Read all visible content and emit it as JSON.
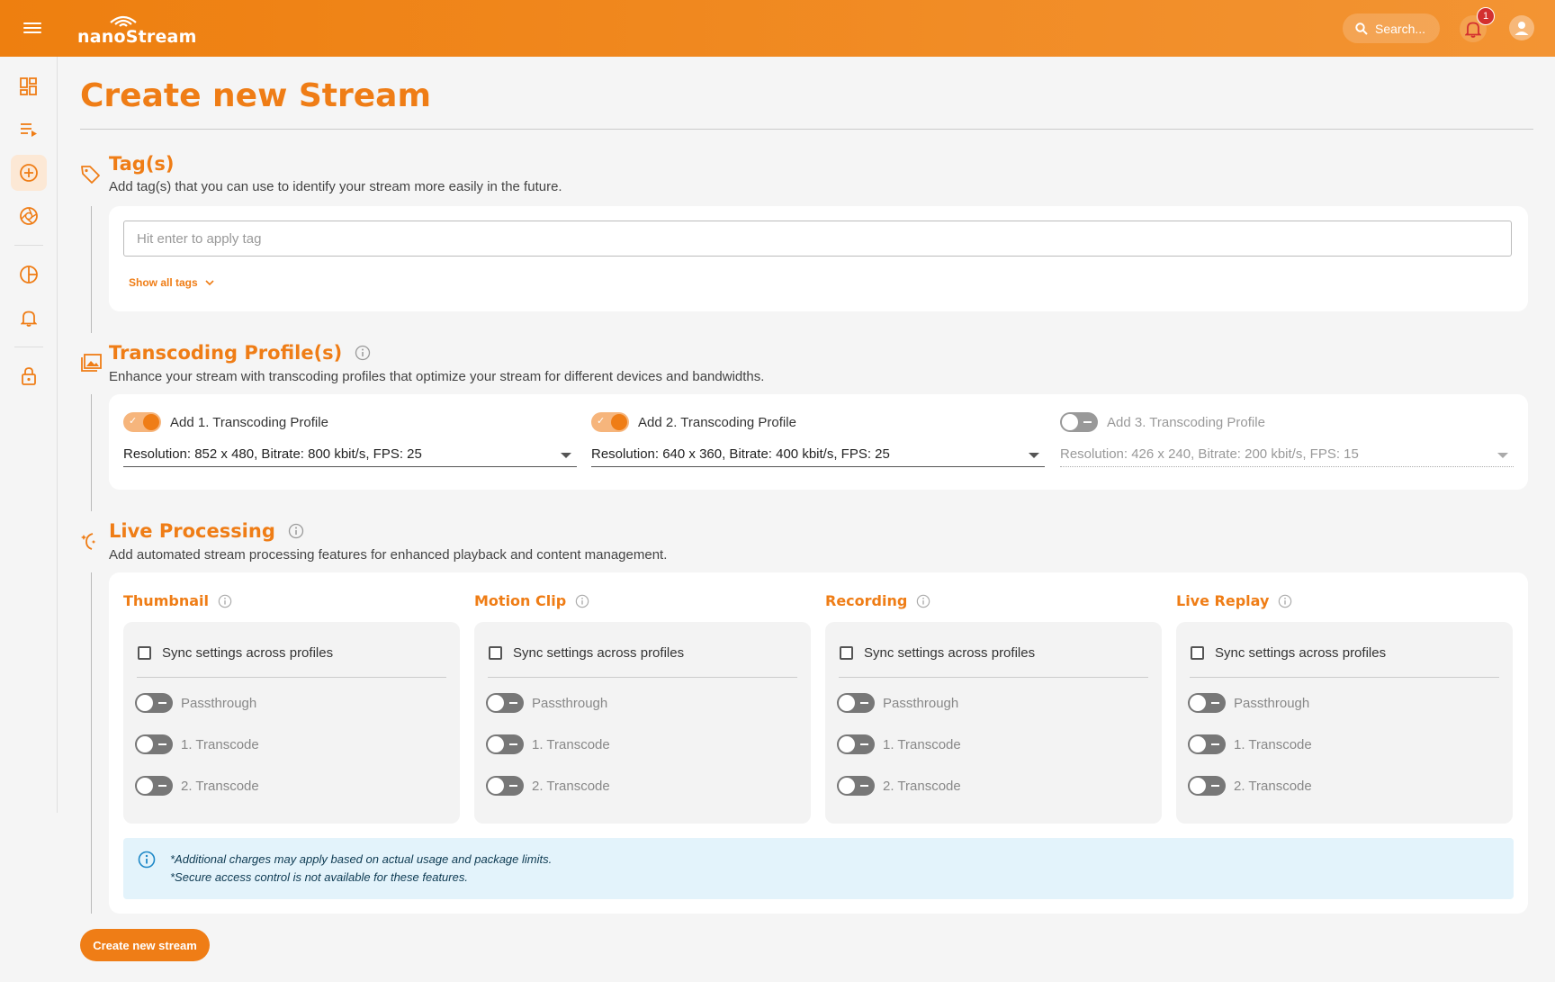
{
  "header": {
    "logo": "nanoStream",
    "search_placeholder": "Search...",
    "notification_count": "1"
  },
  "sidebar": {
    "items": [
      {
        "icon": "dashboard-icon"
      },
      {
        "icon": "stream-list-icon"
      },
      {
        "icon": "add-circle-icon",
        "active": true
      },
      {
        "icon": "aperture-icon"
      },
      {
        "icon": "analytics-icon"
      },
      {
        "icon": "alerts-bell-icon"
      },
      {
        "icon": "lock-icon"
      }
    ]
  },
  "page": {
    "title": "Create new Stream"
  },
  "tags": {
    "title": "Tag(s)",
    "description": "Add tag(s) that you can use to identify your stream more easily in the future.",
    "input_placeholder": "Hit enter to apply tag",
    "show_all_label": "Show all tags"
  },
  "transcoding": {
    "title": "Transcoding Profile(s)",
    "description": "Enhance your stream with transcoding profiles that optimize your stream for different devices and bandwidths.",
    "profiles": [
      {
        "label": "Add 1. Transcoding Profile",
        "enabled": true,
        "value": "Resolution: 852 x 480, Bitrate: 800 kbit/s, FPS: 25"
      },
      {
        "label": "Add 2. Transcoding Profile",
        "enabled": true,
        "value": "Resolution: 640 x 360, Bitrate: 400 kbit/s, FPS: 25"
      },
      {
        "label": "Add 3. Transcoding Profile",
        "enabled": false,
        "value": "Resolution: 426 x 240, Bitrate: 200 kbit/s, FPS: 15"
      }
    ]
  },
  "live_processing": {
    "title": "Live Processing",
    "description": "Add automated stream processing features for enhanced playback and content management.",
    "features": [
      {
        "title": "Thumbnail",
        "sync_label": "Sync settings across profiles",
        "rows": [
          "Passthrough",
          "1. Transcode",
          "2. Transcode"
        ]
      },
      {
        "title": "Motion Clip",
        "sync_label": "Sync settings across profiles",
        "rows": [
          "Passthrough",
          "1. Transcode",
          "2. Transcode"
        ]
      },
      {
        "title": "Recording",
        "sync_label": "Sync settings across profiles",
        "rows": [
          "Passthrough",
          "1. Transcode",
          "2. Transcode"
        ]
      },
      {
        "title": "Live Replay",
        "sync_label": "Sync settings across profiles",
        "rows": [
          "Passthrough",
          "1. Transcode",
          "2. Transcode"
        ]
      }
    ],
    "note_line1": "*Additional charges may apply based on actual usage and package limits.",
    "note_line2": "*Secure access control is not available for these features."
  },
  "actions": {
    "create_label": "Create new stream"
  },
  "colors": {
    "brand": "#ef7d16",
    "note_bg": "#e3f3fb",
    "info_blue": "#1e88c7"
  }
}
